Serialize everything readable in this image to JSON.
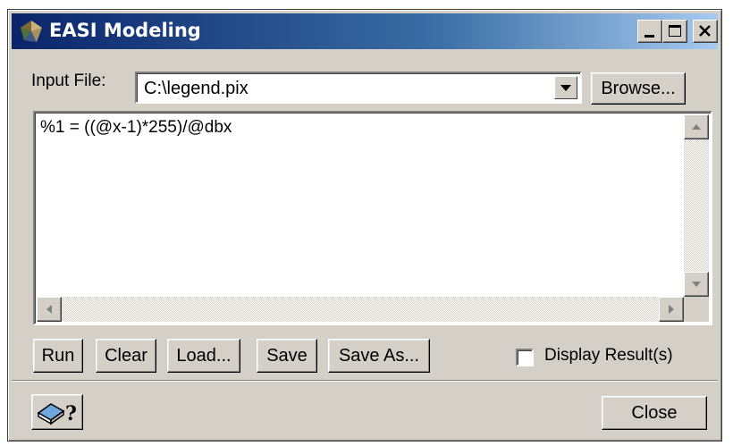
{
  "window": {
    "title": "EASI Modeling",
    "controls": [
      "minimize-icon",
      "maximize-icon",
      "close-icon"
    ]
  },
  "input": {
    "label": "Input File:",
    "value": "C:\\legend.pix",
    "browse_label": "Browse..."
  },
  "editor": {
    "content": "%1 = ((@x-1)*255)/@dbx"
  },
  "toolbar": {
    "run_label": "Run",
    "clear_label": "Clear",
    "load_label": "Load...",
    "save_label": "Save",
    "save_as_label": "Save As..."
  },
  "options": {
    "display_results_label": "Display Result(s)",
    "display_results_checked": false
  },
  "footer": {
    "help_icon": "help-book-icon",
    "close_label": "Close"
  },
  "colors": {
    "titlebar_start": "#0a246a",
    "titlebar_end": "#a6caf0",
    "face": "#d4d0c8"
  }
}
